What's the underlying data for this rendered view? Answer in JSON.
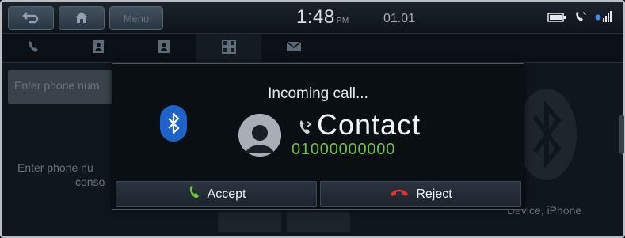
{
  "status_bar": {
    "back_icon": "back-arrow-icon",
    "home_icon": "home-icon",
    "menu_label": "Menu",
    "time": "1:48",
    "ampm": "PM",
    "date": "01.01",
    "icons": [
      "battery-icon",
      "phone-icon",
      "bluetooth-signal-icon"
    ]
  },
  "tabs": [
    {
      "icon": "call-history-icon"
    },
    {
      "icon": "contacts-icon"
    },
    {
      "icon": "favorites-icon"
    },
    {
      "icon": "dial-pad-icon"
    },
    {
      "icon": "messages-icon"
    }
  ],
  "background": {
    "input_placeholder": "Enter phone num",
    "hint_line1": "Enter phone nu",
    "hint_line2": "conso",
    "device_label": "Device, iPhone"
  },
  "popup": {
    "title": "Incoming call...",
    "contact_name": "Contact",
    "contact_number": "01000000000",
    "accept_label": "Accept",
    "reject_label": "Reject"
  },
  "colors": {
    "accept_green": "#6fc43f",
    "reject_red": "#e5332a",
    "bluetooth_blue": "#1e63c9"
  }
}
